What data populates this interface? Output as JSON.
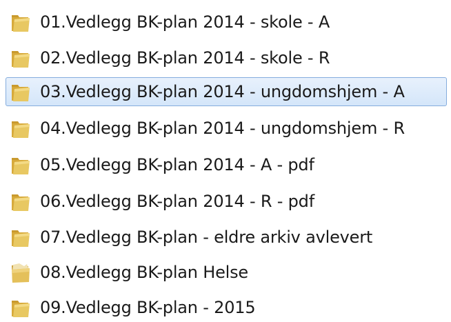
{
  "colors": {
    "folder_body": "#e6c35a",
    "folder_back": "#d7aa3b",
    "selection_bg": "#d4e6fa",
    "selection_border": "#84acdd"
  },
  "items": [
    {
      "label": "01.Vedlegg BK-plan 2014 - skole - A",
      "icon": "folder-icon",
      "selected": false
    },
    {
      "label": "02.Vedlegg BK-plan 2014 - skole - R",
      "icon": "folder-icon",
      "selected": false
    },
    {
      "label": "03.Vedlegg BK-plan 2014 - ungdomshjem - A",
      "icon": "folder-icon",
      "selected": true
    },
    {
      "label": "04.Vedlegg BK-plan 2014 - ungdomshjem - R",
      "icon": "folder-icon",
      "selected": false
    },
    {
      "label": "05.Vedlegg BK-plan 2014 - A - pdf",
      "icon": "folder-icon",
      "selected": false
    },
    {
      "label": "06.Vedlegg BK-plan 2014 - R - pdf",
      "icon": "folder-icon",
      "selected": false
    },
    {
      "label": "07.Vedlegg BK-plan - eldre arkiv avlevert",
      "icon": "folder-icon",
      "selected": false
    },
    {
      "label": "08.Vedlegg BK-plan Helse",
      "icon": "folder-open-icon",
      "selected": false
    },
    {
      "label": "09.Vedlegg BK-plan - 2015",
      "icon": "folder-icon",
      "selected": false
    }
  ]
}
